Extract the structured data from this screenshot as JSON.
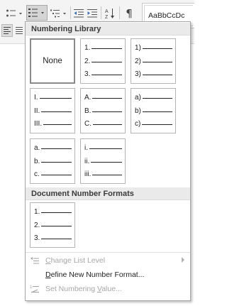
{
  "ribbon": {
    "style_preview": "AaBbCcDc",
    "pilcrow": "¶",
    "icons": {
      "bullets": "bullet-list-icon",
      "numbering": "numbered-list-icon",
      "multilevel": "multilevel-list-icon",
      "decrease_indent": "decrease-indent-icon",
      "increase_indent": "increase-indent-icon",
      "sort": "sort-az-icon",
      "align_left": "align-left-icon",
      "justify": "justify-icon"
    }
  },
  "dropdown": {
    "numbering_library_title": "Numbering Library",
    "document_formats_title": "Document Number Formats",
    "none_label": "None",
    "library": [
      {
        "id": "none",
        "is_none": true
      },
      {
        "id": "arabic-period",
        "items": [
          "1.",
          "2.",
          "3."
        ]
      },
      {
        "id": "arabic-paren",
        "items": [
          "1)",
          "2)",
          "3)"
        ]
      },
      {
        "id": "roman-upper",
        "items": [
          "I.",
          "II.",
          "III."
        ]
      },
      {
        "id": "alpha-upper",
        "items": [
          "A.",
          "B.",
          "C."
        ]
      },
      {
        "id": "alpha-lower-paren",
        "items": [
          "a)",
          "b)",
          "c)"
        ]
      },
      {
        "id": "alpha-lower-period",
        "items": [
          "a.",
          "b.",
          "c."
        ]
      },
      {
        "id": "roman-lower",
        "items": [
          "i.",
          "ii.",
          "iii."
        ]
      }
    ],
    "document_formats": [
      {
        "id": "doc-arabic-period",
        "items": [
          "1.",
          "2.",
          "3."
        ]
      }
    ],
    "menu": {
      "change_list_level": {
        "prefix": "",
        "underline": "C",
        "rest": "hange List Level",
        "enabled": false,
        "icon": "change-list-level-icon"
      },
      "define_new_format": {
        "prefix": "",
        "underline": "D",
        "rest": "efine New Number Format...",
        "enabled": true
      },
      "set_numbering_value": {
        "prefix": "Set Numbering ",
        "underline": "V",
        "rest": "alue...",
        "enabled": false,
        "icon": "set-numbering-value-icon"
      }
    }
  }
}
